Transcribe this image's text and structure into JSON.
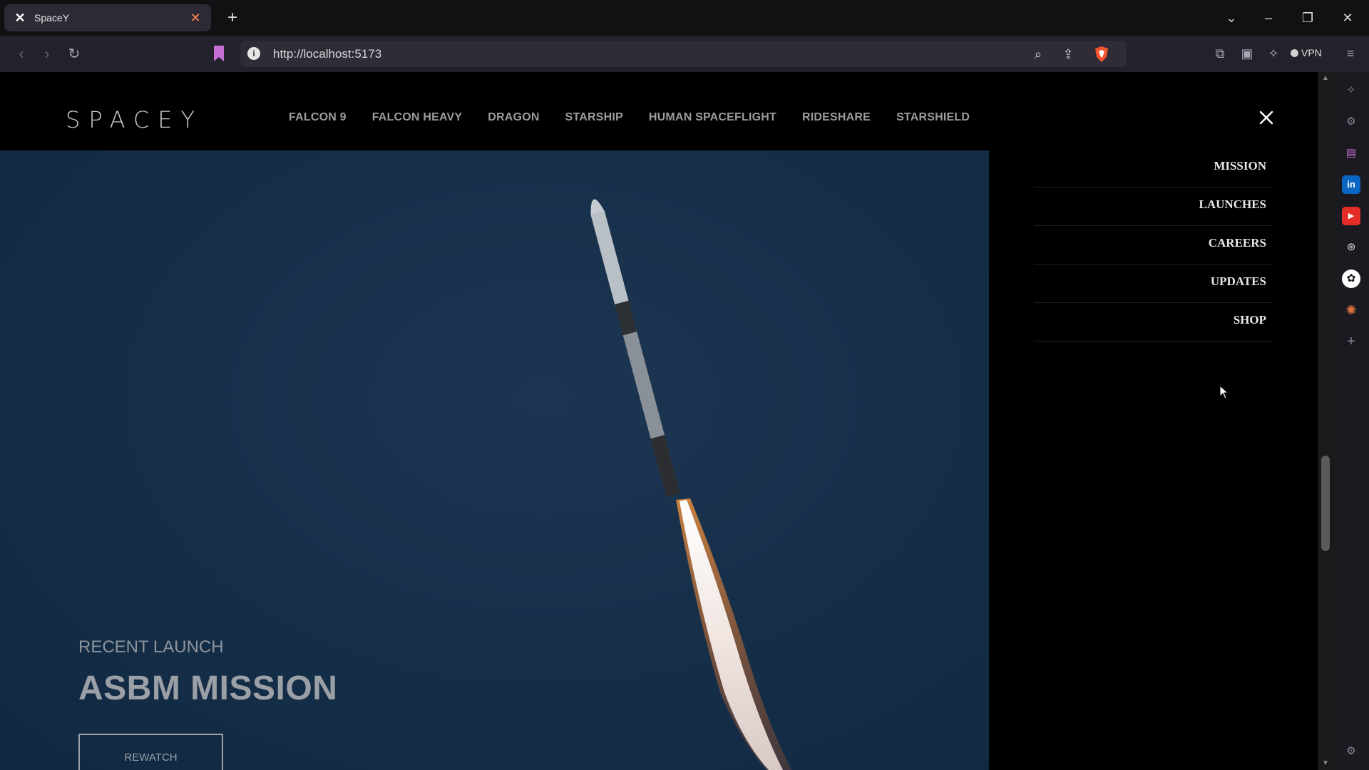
{
  "browser": {
    "tab": {
      "title": "SpaceY",
      "favicon": "x-logo-icon"
    },
    "url": "http://localhost:5173",
    "vpn_label": "VPN"
  },
  "site": {
    "logo": "SPACEY",
    "nav": [
      "FALCON 9",
      "FALCON HEAVY",
      "DRAGON",
      "STARSHIP",
      "HUMAN SPACEFLIGHT",
      "RIDESHARE",
      "STARSHIELD"
    ],
    "side_menu": [
      "MISSION",
      "LAUNCHES",
      "CAREERS",
      "UPDATES",
      "SHOP"
    ],
    "hero": {
      "kicker": "RECENT LAUNCH",
      "title": "ASBM MISSION",
      "button": "REWATCH"
    }
  },
  "colors": {
    "browser_bg": "#111114",
    "toolbar_bg": "#232129",
    "accent": "#ff8a4c",
    "hero_sky": "#16304a"
  }
}
